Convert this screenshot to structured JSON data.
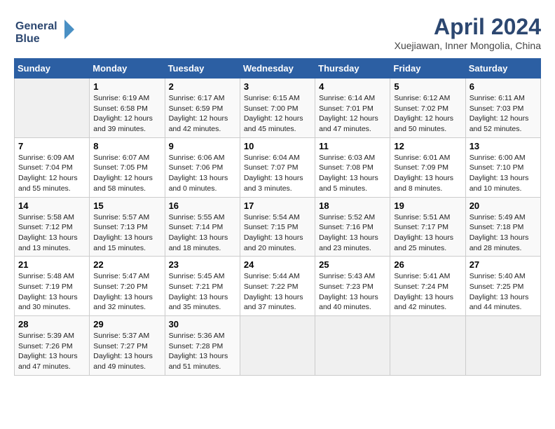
{
  "header": {
    "title": "April 2024",
    "subtitle": "Xuejiawan, Inner Mongolia, China",
    "logo_line1": "General",
    "logo_line2": "Blue"
  },
  "weekdays": [
    "Sunday",
    "Monday",
    "Tuesday",
    "Wednesday",
    "Thursday",
    "Friday",
    "Saturday"
  ],
  "weeks": [
    [
      {
        "day": "",
        "info": ""
      },
      {
        "day": "1",
        "info": "Sunrise: 6:19 AM\nSunset: 6:58 PM\nDaylight: 12 hours\nand 39 minutes."
      },
      {
        "day": "2",
        "info": "Sunrise: 6:17 AM\nSunset: 6:59 PM\nDaylight: 12 hours\nand 42 minutes."
      },
      {
        "day": "3",
        "info": "Sunrise: 6:15 AM\nSunset: 7:00 PM\nDaylight: 12 hours\nand 45 minutes."
      },
      {
        "day": "4",
        "info": "Sunrise: 6:14 AM\nSunset: 7:01 PM\nDaylight: 12 hours\nand 47 minutes."
      },
      {
        "day": "5",
        "info": "Sunrise: 6:12 AM\nSunset: 7:02 PM\nDaylight: 12 hours\nand 50 minutes."
      },
      {
        "day": "6",
        "info": "Sunrise: 6:11 AM\nSunset: 7:03 PM\nDaylight: 12 hours\nand 52 minutes."
      }
    ],
    [
      {
        "day": "7",
        "info": "Sunrise: 6:09 AM\nSunset: 7:04 PM\nDaylight: 12 hours\nand 55 minutes."
      },
      {
        "day": "8",
        "info": "Sunrise: 6:07 AM\nSunset: 7:05 PM\nDaylight: 12 hours\nand 58 minutes."
      },
      {
        "day": "9",
        "info": "Sunrise: 6:06 AM\nSunset: 7:06 PM\nDaylight: 13 hours\nand 0 minutes."
      },
      {
        "day": "10",
        "info": "Sunrise: 6:04 AM\nSunset: 7:07 PM\nDaylight: 13 hours\nand 3 minutes."
      },
      {
        "day": "11",
        "info": "Sunrise: 6:03 AM\nSunset: 7:08 PM\nDaylight: 13 hours\nand 5 minutes."
      },
      {
        "day": "12",
        "info": "Sunrise: 6:01 AM\nSunset: 7:09 PM\nDaylight: 13 hours\nand 8 minutes."
      },
      {
        "day": "13",
        "info": "Sunrise: 6:00 AM\nSunset: 7:10 PM\nDaylight: 13 hours\nand 10 minutes."
      }
    ],
    [
      {
        "day": "14",
        "info": "Sunrise: 5:58 AM\nSunset: 7:12 PM\nDaylight: 13 hours\nand 13 minutes."
      },
      {
        "day": "15",
        "info": "Sunrise: 5:57 AM\nSunset: 7:13 PM\nDaylight: 13 hours\nand 15 minutes."
      },
      {
        "day": "16",
        "info": "Sunrise: 5:55 AM\nSunset: 7:14 PM\nDaylight: 13 hours\nand 18 minutes."
      },
      {
        "day": "17",
        "info": "Sunrise: 5:54 AM\nSunset: 7:15 PM\nDaylight: 13 hours\nand 20 minutes."
      },
      {
        "day": "18",
        "info": "Sunrise: 5:52 AM\nSunset: 7:16 PM\nDaylight: 13 hours\nand 23 minutes."
      },
      {
        "day": "19",
        "info": "Sunrise: 5:51 AM\nSunset: 7:17 PM\nDaylight: 13 hours\nand 25 minutes."
      },
      {
        "day": "20",
        "info": "Sunrise: 5:49 AM\nSunset: 7:18 PM\nDaylight: 13 hours\nand 28 minutes."
      }
    ],
    [
      {
        "day": "21",
        "info": "Sunrise: 5:48 AM\nSunset: 7:19 PM\nDaylight: 13 hours\nand 30 minutes."
      },
      {
        "day": "22",
        "info": "Sunrise: 5:47 AM\nSunset: 7:20 PM\nDaylight: 13 hours\nand 32 minutes."
      },
      {
        "day": "23",
        "info": "Sunrise: 5:45 AM\nSunset: 7:21 PM\nDaylight: 13 hours\nand 35 minutes."
      },
      {
        "day": "24",
        "info": "Sunrise: 5:44 AM\nSunset: 7:22 PM\nDaylight: 13 hours\nand 37 minutes."
      },
      {
        "day": "25",
        "info": "Sunrise: 5:43 AM\nSunset: 7:23 PM\nDaylight: 13 hours\nand 40 minutes."
      },
      {
        "day": "26",
        "info": "Sunrise: 5:41 AM\nSunset: 7:24 PM\nDaylight: 13 hours\nand 42 minutes."
      },
      {
        "day": "27",
        "info": "Sunrise: 5:40 AM\nSunset: 7:25 PM\nDaylight: 13 hours\nand 44 minutes."
      }
    ],
    [
      {
        "day": "28",
        "info": "Sunrise: 5:39 AM\nSunset: 7:26 PM\nDaylight: 13 hours\nand 47 minutes."
      },
      {
        "day": "29",
        "info": "Sunrise: 5:37 AM\nSunset: 7:27 PM\nDaylight: 13 hours\nand 49 minutes."
      },
      {
        "day": "30",
        "info": "Sunrise: 5:36 AM\nSunset: 7:28 PM\nDaylight: 13 hours\nand 51 minutes."
      },
      {
        "day": "",
        "info": ""
      },
      {
        "day": "",
        "info": ""
      },
      {
        "day": "",
        "info": ""
      },
      {
        "day": "",
        "info": ""
      }
    ]
  ]
}
